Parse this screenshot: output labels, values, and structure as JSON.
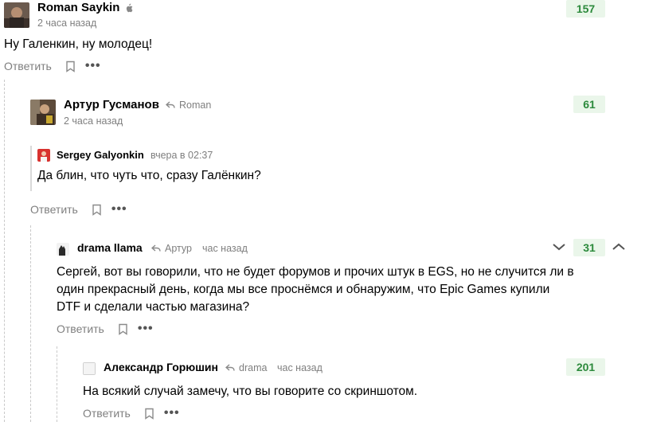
{
  "comments": [
    {
      "author": "Roman Saykin",
      "time": "2 часа назад",
      "text": "Ну Галенкин, ну молодец!",
      "score": "157",
      "reply_label": "Ответить",
      "more_label": "•••"
    },
    {
      "author": "Артур Гусманов",
      "reply_to": "Roman",
      "time": "2 часа назад",
      "score": "61",
      "quote": {
        "author": "Sergey Galyonkin",
        "time": "вчера в 02:37"
      },
      "text": "Да блин, что чуть что, сразу Галёнкин?",
      "reply_label": "Ответить",
      "more_label": "•••"
    },
    {
      "author": "drama llama",
      "reply_to": "Артур",
      "time": "час назад",
      "score": "31",
      "text": "Сергей, вот вы говорили, что не будет форумов и прочих штук в EGS, но не случится ли в один прекрасный день, когда мы все проснёмся и обнаружим, что Epic Games купили DTF и сделали частью магазина?",
      "reply_label": "Ответить",
      "more_label": "•••"
    },
    {
      "author": "Александр Горюшин",
      "reply_to": "drama",
      "time": "час назад",
      "score": "201",
      "text": "На всякий случай замечу, что вы говорите со скриншотом.",
      "reply_label": "Ответить",
      "more_label": "•••"
    }
  ],
  "colors": {
    "score_bg": "#eaf6ea",
    "score_text": "#2c8a3c",
    "muted": "#7f7f7f",
    "sergey_avatar": "#d8322f"
  },
  "icons": {
    "platform": "apple-icon",
    "reply_arrow": "reply-arrow-icon",
    "bookmark": "bookmark-icon",
    "vote_down": "chevron-down-icon",
    "vote_up": "chevron-up-icon"
  }
}
